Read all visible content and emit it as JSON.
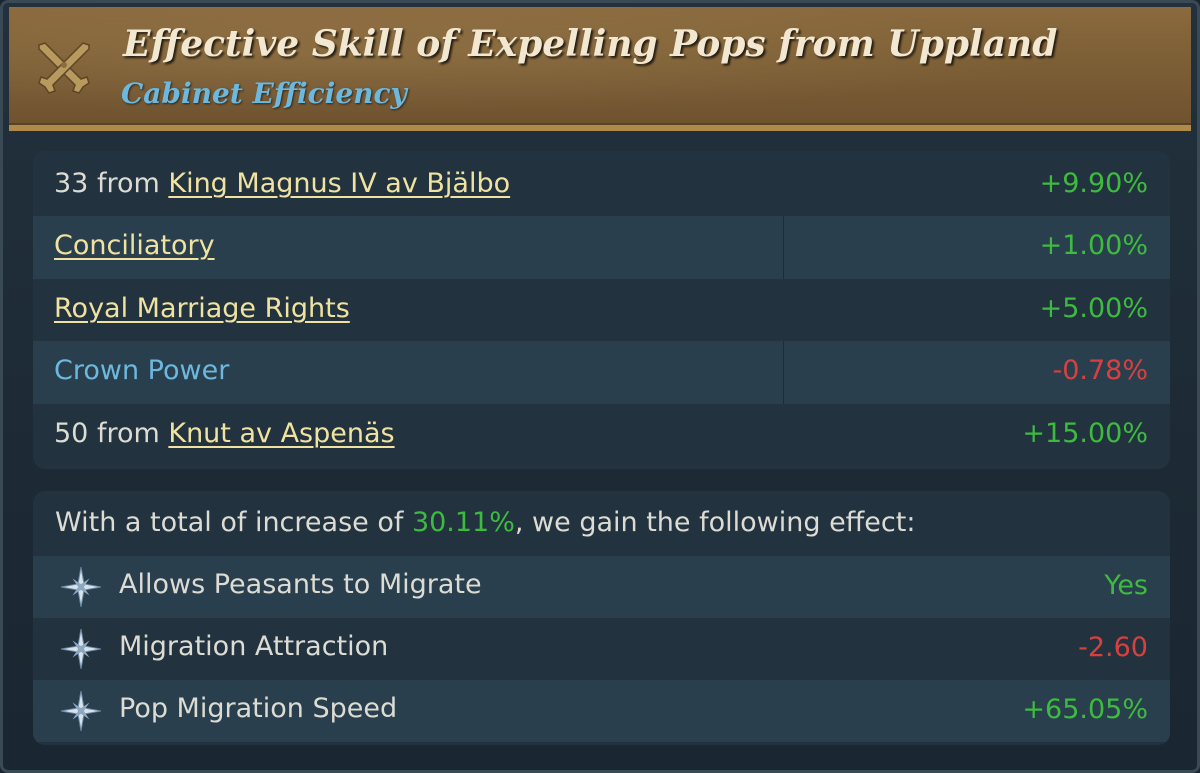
{
  "header": {
    "title": "Effective Skill of Expelling Pops from Uppland",
    "subtitle": "Cabinet Efficiency",
    "icon": "crossed-swords-icon"
  },
  "modifiers": [
    {
      "prefix": "33 from ",
      "link": "King Magnus IV av Bjälbo",
      "value": "+9.90%",
      "sign": "positive"
    },
    {
      "prefix": "",
      "link": "Conciliatory",
      "value": "+1.00%",
      "sign": "positive"
    },
    {
      "prefix": "",
      "link": "Royal Marriage Rights",
      "value": "+5.00%",
      "sign": "positive"
    },
    {
      "prefix": "",
      "label": "Crown Power",
      "value": "-0.78%",
      "sign": "negative"
    },
    {
      "prefix": "50 from ",
      "link": "Knut av Aspenäs",
      "value": "+15.00%",
      "sign": "positive"
    }
  ],
  "summary": {
    "before": "With a total of increase of ",
    "total": "30.11%",
    "after": ", we gain the following effect:"
  },
  "effects": [
    {
      "icon": "star-icon",
      "label": "Allows Peasants to Migrate",
      "value": "Yes",
      "sign": "positive"
    },
    {
      "icon": "star-icon",
      "label": "Migration Attraction",
      "value": "-2.60",
      "sign": "negative"
    },
    {
      "icon": "star-icon",
      "label": "Pop Migration Speed",
      "value": "+65.05%",
      "sign": "positive"
    }
  ],
  "colors": {
    "positive": "#3dbb3f",
    "negative": "#d84040",
    "link": "#f0e2a0",
    "subtitle": "#6cb8de",
    "header_bg": "#7d5f36"
  }
}
